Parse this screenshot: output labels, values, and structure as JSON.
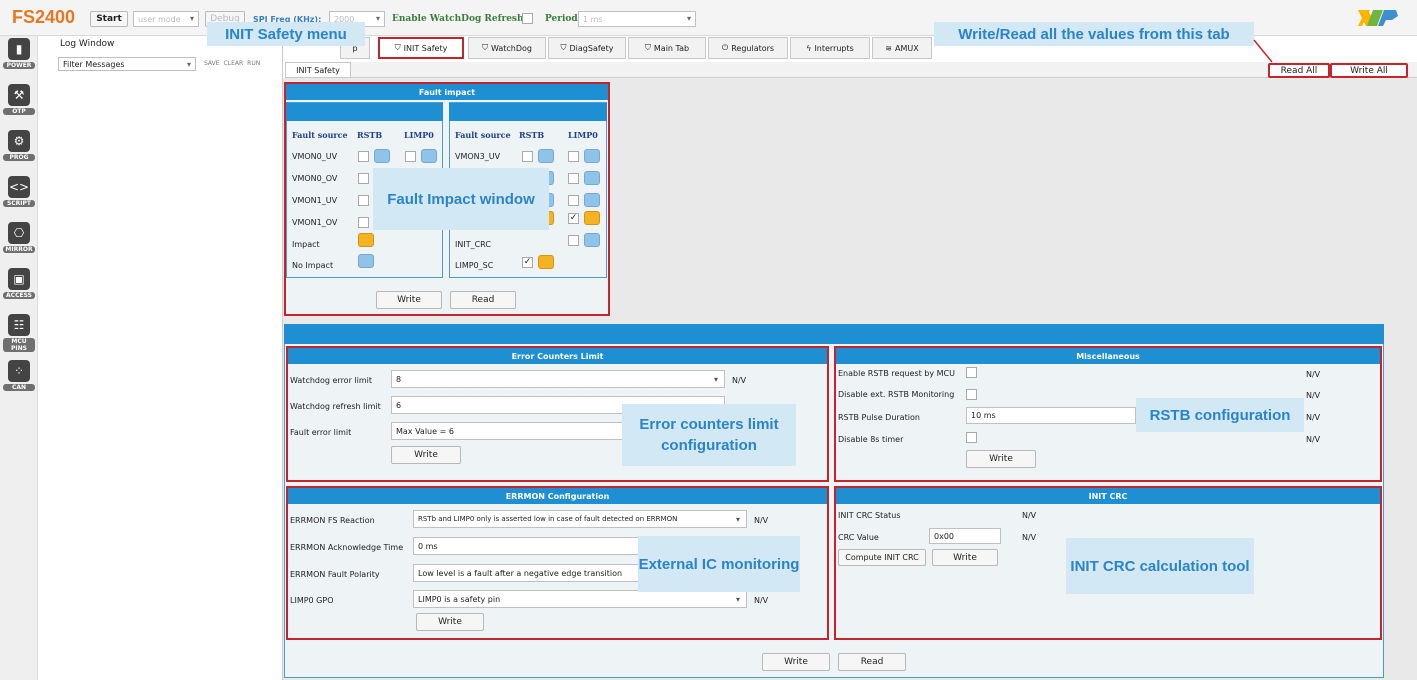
{
  "app": {
    "brand": "FS2400"
  },
  "toolbar": {
    "start": "Start",
    "mode_value": "user mode",
    "debug": "Debug",
    "spi_label": "SPI Freq (KHz):",
    "spi_value": "2000",
    "watchdog_label": "Enable WatchDog Refresh",
    "period_label": "Period",
    "period_value": "1 ms"
  },
  "sidebar": {
    "items": [
      {
        "label": "POWER",
        "icon": "power-icon"
      },
      {
        "label": "OTP",
        "icon": "hammer-icon"
      },
      {
        "label": "PROG",
        "icon": "gear-icon"
      },
      {
        "label": "SCRIPT",
        "icon": "code-icon"
      },
      {
        "label": "MIRROR",
        "icon": "mirror-icon"
      },
      {
        "label": "ACCESS",
        "icon": "chip-icon"
      },
      {
        "label": "MCU PINS",
        "icon": "pins-icon"
      },
      {
        "label": "CAN",
        "icon": "can-icon"
      }
    ]
  },
  "log": {
    "title": "Log Window",
    "filter": "Filter Messages",
    "save": "SAVE",
    "clear": "CLEAR",
    "run": "RUN"
  },
  "tabs": [
    "p",
    "INIT Safety",
    "WatchDog",
    "DiagSafety",
    "Main Tab",
    "Regulators",
    "Interrupts",
    "AMUX"
  ],
  "subtab": "INIT Safety",
  "buttons": {
    "read_all": "Read All",
    "write_all": "Write All",
    "write": "Write",
    "read": "Read",
    "compute_crc": "Compute INIT CRC"
  },
  "fault_impact": {
    "title": "Fault impact",
    "col_source": "Fault source",
    "col_rstb": "RSTB",
    "col_limp": "LIMP0",
    "left_rows": [
      "VMON0_UV",
      "VMON0_OV",
      "VMON1_UV",
      "VMON1_OV",
      "Impact",
      "No Impact"
    ],
    "right_rows": [
      "VMON3_UV",
      "",
      "",
      "",
      "INIT_CRC",
      "LIMP0_SC"
    ],
    "check_mark": "✓"
  },
  "error_counters": {
    "title": "Error Counters Limit",
    "rows": [
      {
        "label": "Watchdog error limit",
        "value": "8",
        "na": "N/V"
      },
      {
        "label": "Watchdog refresh limit",
        "value": "6",
        "na": "N/V"
      },
      {
        "label": "Fault error limit",
        "value": "Max Value = 6",
        "na": ""
      }
    ]
  },
  "misc": {
    "title": "Miscellaneous",
    "rows": [
      {
        "label": "Enable RSTB request by MCU",
        "na": "N/V"
      },
      {
        "label": "Disable ext. RSTB Monitoring",
        "na": "N/V"
      },
      {
        "label": "RSTB Pulse Duration",
        "value": "10 ms",
        "na": "N/V"
      },
      {
        "label": "Disable 8s timer",
        "na": "N/V"
      }
    ]
  },
  "errmon": {
    "title": "ERRMON Configuration",
    "rows": [
      {
        "label": "ERRMON FS Reaction",
        "value": "RSTb and LIMP0 only is asserted low in case of fault detected on ERRMON",
        "na": "N/V"
      },
      {
        "label": "ERRMON Acknowledge Time",
        "value": "0 ms",
        "na": ""
      },
      {
        "label": "ERRMON Fault Polarity",
        "value": "Low level is a fault after a negative edge transition",
        "na": ""
      },
      {
        "label": "LIMP0 GPO",
        "value": "LIMP0 is a safety pin",
        "na": "N/V"
      }
    ]
  },
  "init_crc": {
    "title": "INIT CRC",
    "status_label": "INIT CRC Status",
    "status_na": "N/V",
    "value_label": "CRC Value",
    "value": "0x00",
    "value_na": "N/V"
  },
  "callouts": {
    "init_menu": "INIT Safety menu",
    "write_read": "Write/Read all the values from this tab",
    "fault_window": "Fault Impact window",
    "error_counters": "Error counters limit configuration",
    "rstb": "RSTB configuration",
    "external_ic": "External IC monitoring",
    "crc_tool": "INIT CRC calculation tool"
  },
  "colors": {
    "brand": "#e87722",
    "accent_blue": "#1f8fd3",
    "highlight_red": "#c4242c",
    "impact_orange": "#f6b321",
    "no_impact_blue": "#8ec3ea",
    "callout_bg": "#d3e8f5",
    "callout_text": "#2b84c7"
  }
}
